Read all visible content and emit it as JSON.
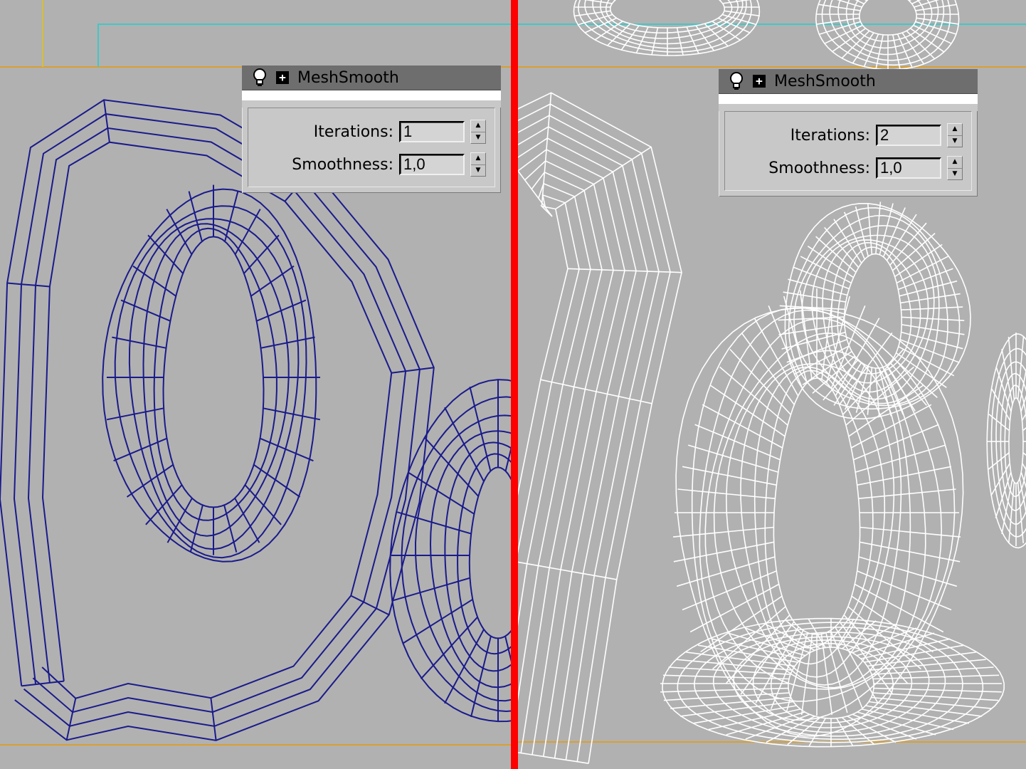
{
  "left_panel": {
    "title": "MeshSmooth",
    "iterations_label": "Iterations:",
    "iterations_value": "1",
    "smoothness_label": "Smoothness:",
    "smoothness_value": "1,0"
  },
  "right_panel": {
    "title": "MeshSmooth",
    "iterations_label": "Iterations:",
    "iterations_value": "2",
    "smoothness_label": "Smoothness:",
    "smoothness_value": "1,0"
  },
  "colors": {
    "viewport_bg": "#b1b1b1",
    "left_wire": "#1a1a8c",
    "right_wire": "#ffffff",
    "divider": "#ff0000",
    "guide_orange": "#d9a030",
    "guide_cyan": "#40c8c8"
  },
  "icons": {
    "bulb": "lightbulb-icon",
    "expand": "plus-icon",
    "spinner_up": "up-arrow",
    "spinner_down": "down-arrow"
  }
}
